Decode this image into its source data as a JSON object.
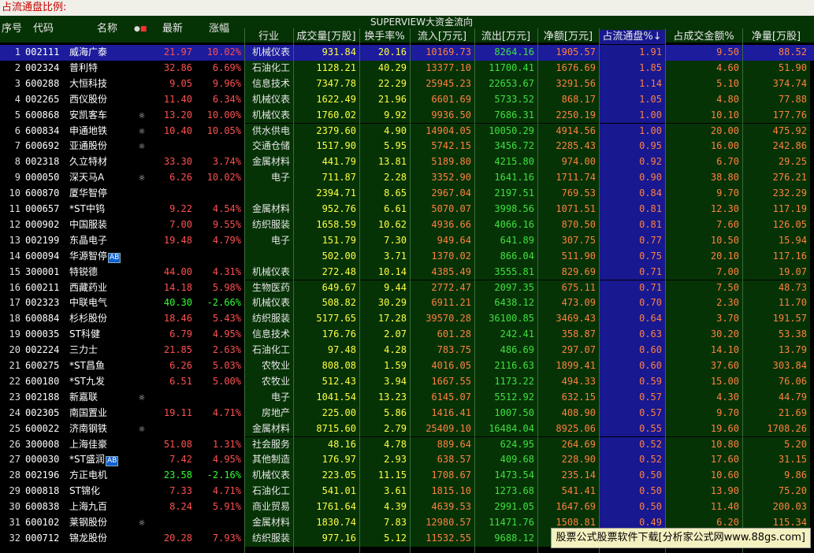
{
  "title": "占流通盘比例:",
  "super_header": "SUPERVIEW大资金流向",
  "headers": {
    "seq": "序号",
    "code": "代码",
    "name": "名称",
    "price": "最新",
    "change": "涨幅",
    "industry": "行业",
    "volume": "成交量[万股]",
    "turnover": "换手率%",
    "inflow": "流入[万元]",
    "outflow": "流出[万元]",
    "net": "净额[万元]",
    "float_pct": "占流通盘%↓",
    "amount_pct": "占成交金额%",
    "net_shares": "净量[万股]"
  },
  "colors": {
    "price_up": "#ff5050",
    "price_down": "#30ff30",
    "value_orange": "#ff8040",
    "value_green": "#40e040",
    "value_yellow": "#ffff40",
    "industry_text": "#e8e8e8",
    "code_text": "#ffffff",
    "name_text": "#ffffff"
  },
  "rows": [
    [
      "1",
      "002111",
      "威海广泰",
      "",
      "21.97",
      "10.02%",
      "机械仪表",
      "931.84",
      "20.16",
      "10169.73",
      "8264.16",
      "1905.57",
      "1.91",
      "9.50",
      "88.52"
    ],
    [
      "2",
      "002324",
      "普利特",
      "",
      "32.86",
      "6.69%",
      "石油化工",
      "1128.21",
      "40.29",
      "13377.10",
      "11700.41",
      "1676.69",
      "1.85",
      "4.60",
      "51.90"
    ],
    [
      "3",
      "600288",
      "大恒科技",
      "",
      "9.05",
      "9.96%",
      "信息技术",
      "7347.78",
      "22.29",
      "25945.23",
      "22653.67",
      "3291.56",
      "1.14",
      "5.10",
      "374.74"
    ],
    [
      "4",
      "002265",
      "西仪股份",
      "",
      "11.40",
      "6.34%",
      "机械仪表",
      "1622.49",
      "21.96",
      "6601.69",
      "5733.52",
      "868.17",
      "1.05",
      "4.80",
      "77.88"
    ],
    [
      "5",
      "600868",
      "安凯客车",
      "star",
      "13.20",
      "10.00%",
      "机械仪表",
      "1760.02",
      "9.92",
      "9936.50",
      "7686.31",
      "2250.19",
      "1.00",
      "10.10",
      "177.76"
    ],
    [
      "6",
      "600834",
      "申通地铁",
      "star",
      "10.40",
      "10.05%",
      "供水供电",
      "2379.60",
      "4.90",
      "14904.05",
      "10050.29",
      "4914.56",
      "1.00",
      "20.00",
      "475.92"
    ],
    [
      "7",
      "600692",
      "亚通股份",
      "star",
      "",
      "",
      "交通仓储",
      "1517.90",
      "5.95",
      "5742.15",
      "3456.72",
      "2285.43",
      "0.95",
      "16.00",
      "242.86"
    ],
    [
      "8",
      "002318",
      "久立特材",
      "",
      "33.30",
      "3.74%",
      "金属材料",
      "441.79",
      "13.81",
      "5189.80",
      "4215.80",
      "974.00",
      "0.92",
      "6.70",
      "29.25"
    ],
    [
      "9",
      "000050",
      "深天马A",
      "star",
      "6.26",
      "10.02%",
      "电子",
      "711.87",
      "2.28",
      "3352.90",
      "1641.16",
      "1711.74",
      "0.90",
      "38.80",
      "276.21"
    ],
    [
      "10",
      "600870",
      "厦华智停",
      "",
      "",
      "",
      "",
      "2394.71",
      "8.65",
      "2967.04",
      "2197.51",
      "769.53",
      "0.84",
      "9.70",
      "232.29"
    ],
    [
      "11",
      "000657",
      "*ST中钨",
      "",
      "9.22",
      "4.54%",
      "金属材料",
      "952.76",
      "6.61",
      "5070.07",
      "3998.56",
      "1071.51",
      "0.81",
      "12.30",
      "117.19"
    ],
    [
      "12",
      "000902",
      "中国服装",
      "",
      "7.00",
      "9.55%",
      "纺织服装",
      "1658.59",
      "10.62",
      "4936.66",
      "4066.16",
      "870.50",
      "0.81",
      "7.60",
      "126.05"
    ],
    [
      "13",
      "002199",
      "东晶电子",
      "",
      "19.48",
      "4.79%",
      "电子",
      "151.79",
      "7.30",
      "949.64",
      "641.89",
      "307.75",
      "0.77",
      "10.50",
      "15.94"
    ],
    [
      "14",
      "600094",
      "华源智停",
      "AB",
      "",
      "",
      "",
      "502.00",
      "3.71",
      "1370.02",
      "866.04",
      "511.90",
      "0.75",
      "20.10",
      "117.16"
    ],
    [
      "15",
      "300001",
      "特锐德",
      "",
      "44.00",
      "4.31%",
      "机械仪表",
      "272.48",
      "10.14",
      "4385.49",
      "3555.81",
      "829.69",
      "0.71",
      "7.00",
      "19.07"
    ],
    [
      "16",
      "600211",
      "西藏药业",
      "",
      "14.18",
      "5.98%",
      "生物医药",
      "649.67",
      "9.44",
      "2772.47",
      "2097.35",
      "675.11",
      "0.71",
      "7.50",
      "48.73"
    ],
    [
      "17",
      "002323",
      "中联电气",
      "",
      "40.30",
      "-2.66%",
      "机械仪表",
      "508.82",
      "30.29",
      "6911.21",
      "6438.12",
      "473.09",
      "0.70",
      "2.30",
      "11.70"
    ],
    [
      "18",
      "600884",
      "杉杉股份",
      "",
      "18.46",
      "5.43%",
      "纺织服装",
      "5177.65",
      "17.28",
      "39570.28",
      "36100.85",
      "3469.43",
      "0.64",
      "3.70",
      "191.57"
    ],
    [
      "19",
      "000035",
      "ST科健",
      "",
      "6.79",
      "4.95%",
      "信息技术",
      "176.76",
      "2.07",
      "601.28",
      "242.41",
      "358.87",
      "0.63",
      "30.20",
      "53.38"
    ],
    [
      "20",
      "002224",
      "三力士",
      "",
      "21.85",
      "2.63%",
      "石油化工",
      "97.48",
      "4.28",
      "783.75",
      "486.69",
      "297.07",
      "0.60",
      "14.10",
      "13.79"
    ],
    [
      "21",
      "600275",
      "*ST昌鱼",
      "",
      "6.26",
      "5.03%",
      "农牧业",
      "808.08",
      "1.59",
      "4016.05",
      "2116.63",
      "1899.41",
      "0.60",
      "37.60",
      "303.84"
    ],
    [
      "22",
      "600180",
      "*ST九发",
      "",
      "6.51",
      "5.00%",
      "农牧业",
      "512.43",
      "3.94",
      "1667.55",
      "1173.22",
      "494.33",
      "0.59",
      "15.00",
      "76.06"
    ],
    [
      "23",
      "002188",
      "新嘉联",
      "star",
      "",
      "",
      "电子",
      "1041.54",
      "13.23",
      "6145.07",
      "5512.92",
      "632.15",
      "0.57",
      "4.30",
      "44.79"
    ],
    [
      "24",
      "002305",
      "南国置业",
      "",
      "19.11",
      "4.71%",
      "房地产",
      "225.00",
      "5.86",
      "1416.41",
      "1007.50",
      "408.90",
      "0.57",
      "9.70",
      "21.69"
    ],
    [
      "25",
      "600022",
      "济南钢铁",
      "star",
      "",
      "",
      "金属材料",
      "8715.60",
      "2.79",
      "25409.10",
      "16484.04",
      "8925.06",
      "0.55",
      "19.60",
      "1708.26"
    ],
    [
      "26",
      "300008",
      "上海佳豪",
      "",
      "51.08",
      "1.31%",
      "社会服务",
      "48.16",
      "4.78",
      "889.64",
      "624.95",
      "264.69",
      "0.52",
      "10.80",
      "5.20"
    ],
    [
      "27",
      "000030",
      "*ST盛润",
      "AB",
      "7.42",
      "4.95%",
      "其他制造",
      "176.97",
      "2.93",
      "638.57",
      "409.68",
      "228.90",
      "0.52",
      "17.60",
      "31.15"
    ],
    [
      "28",
      "002196",
      "方正电机",
      "",
      "23.58",
      "-2.16%",
      "机械仪表",
      "223.05",
      "11.15",
      "1708.67",
      "1473.54",
      "235.14",
      "0.50",
      "10.60",
      "9.86"
    ],
    [
      "29",
      "000818",
      "ST锦化",
      "",
      "7.33",
      "4.71%",
      "石油化工",
      "541.01",
      "3.61",
      "1815.10",
      "1273.68",
      "541.41",
      "0.50",
      "13.90",
      "75.20"
    ],
    [
      "30",
      "600838",
      "上海九百",
      "",
      "8.24",
      "5.91%",
      "商业贸易",
      "1761.64",
      "4.39",
      "4639.53",
      "2991.05",
      "1647.69",
      "0.50",
      "11.40",
      "200.03"
    ],
    [
      "31",
      "600102",
      "莱钢股份",
      "star",
      "",
      "",
      "金属材料",
      "1830.74",
      "7.83",
      "12980.57",
      "11471.76",
      "1508.81",
      "0.49",
      "6.20",
      "115.34"
    ],
    [
      "32",
      "000712",
      "锦龙股份",
      "",
      "20.28",
      "7.93%",
      "纺织服装",
      "977.16",
      "5.12",
      "11532.55",
      "9688.12",
      "1844.43",
      "0.48",
      "16.00",
      "90.95"
    ]
  ],
  "watermark": "股票公式股票软件下载[分析家公式网www.88gs.com]"
}
